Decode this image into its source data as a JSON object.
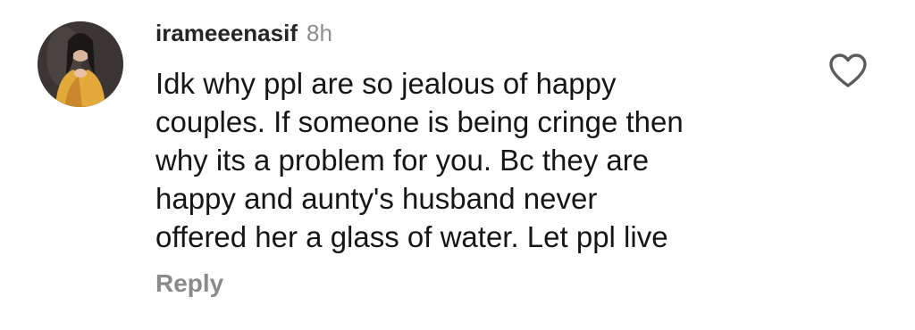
{
  "comment": {
    "username": "irameeenasif",
    "time": "8h",
    "lines": [
      "Idk why ppl are so jealous of happy",
      "couples. If someone is being cringe then",
      "why its a problem for you. Bc they are",
      "happy and aunty's husband never",
      "offered her a glass of water. Let ppl live"
    ],
    "reply_label": "Reply",
    "like_icon": "heart-outline-icon"
  },
  "colors": {
    "username": "#262626",
    "time": "#8e8e8e",
    "text": "#161616",
    "reply": "#8a8a8a",
    "background": "#ffffff"
  }
}
